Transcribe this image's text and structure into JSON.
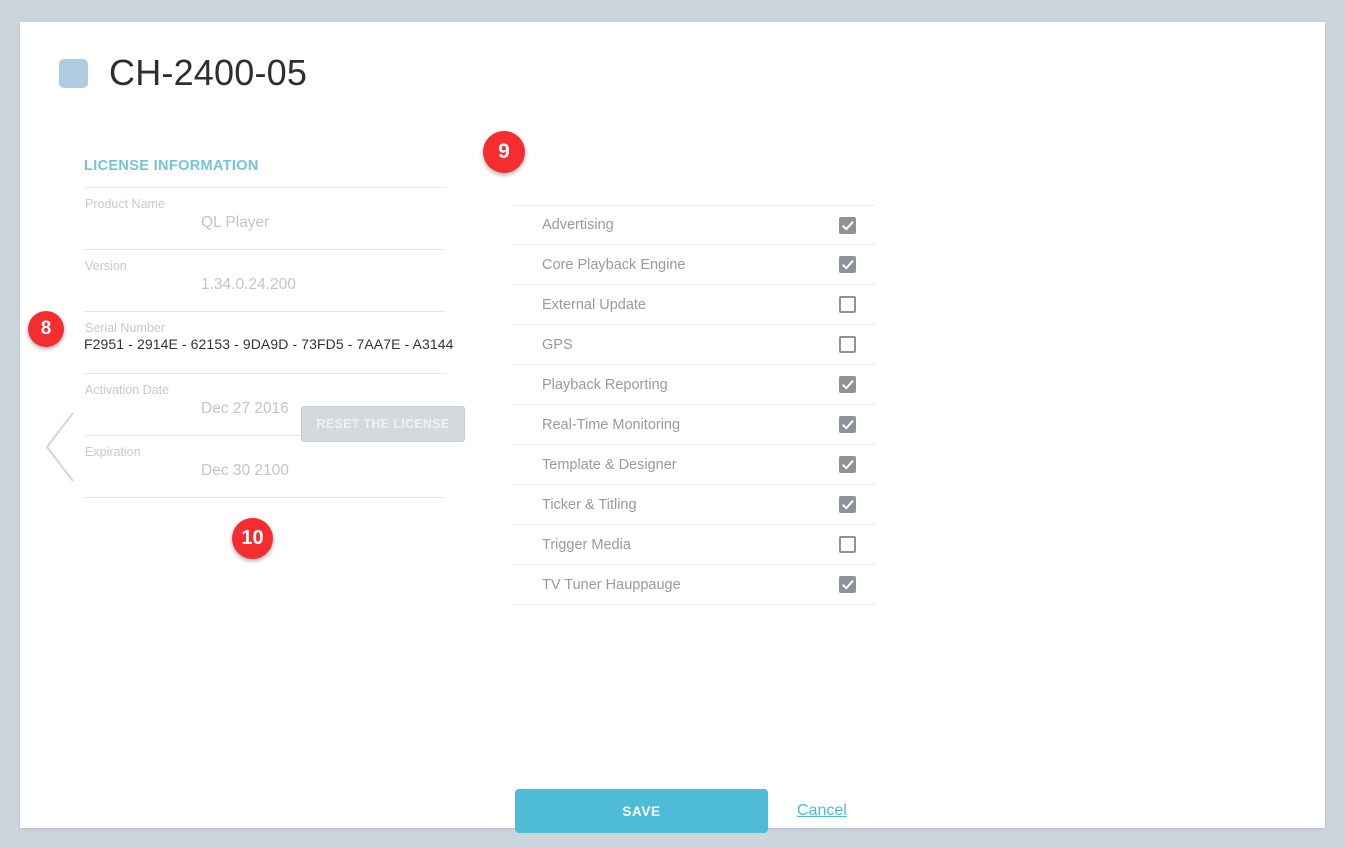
{
  "header": {
    "title": "CH-2400-05",
    "icon": "rounded-square-icon",
    "icon_color": "#afcbe2"
  },
  "navigation": {
    "back_icon": "chevron-left-icon"
  },
  "license": {
    "section_title": "LICENSE INFORMATION",
    "section_title_color": "#72c4dc",
    "fields": [
      {
        "label": "Product Name",
        "value": "QL Player"
      },
      {
        "label": "Version",
        "value": "1.34.0.24.200"
      },
      {
        "label": "Serial Number",
        "value": "F2951 - 2914E - 62153 - 9DA9D - 73FD5 - 7AA7E - A3144"
      },
      {
        "label": "Activation Date",
        "value": "Dec 27 2016"
      },
      {
        "label": "Expiration",
        "value": "Dec 30 2100"
      }
    ],
    "reset_button_label": "RESET THE LICENSE"
  },
  "features": [
    {
      "label": "Advertising",
      "checked": true
    },
    {
      "label": "Core Playback Engine",
      "checked": true
    },
    {
      "label": "External Update",
      "checked": false
    },
    {
      "label": "GPS",
      "checked": false
    },
    {
      "label": "Playback Reporting",
      "checked": true
    },
    {
      "label": "Real-Time Monitoring",
      "checked": true
    },
    {
      "label": "Template & Designer",
      "checked": true
    },
    {
      "label": "Ticker & Titling",
      "checked": true
    },
    {
      "label": "Trigger Media",
      "checked": false
    },
    {
      "label": "TV Tuner Hauppauge",
      "checked": true
    }
  ],
  "footer": {
    "save_label": "SAVE",
    "cancel_label": "Cancel",
    "save_color": "#4ebcd6"
  },
  "annotations": [
    {
      "number": "8"
    },
    {
      "number": "9"
    },
    {
      "number": "10"
    }
  ]
}
